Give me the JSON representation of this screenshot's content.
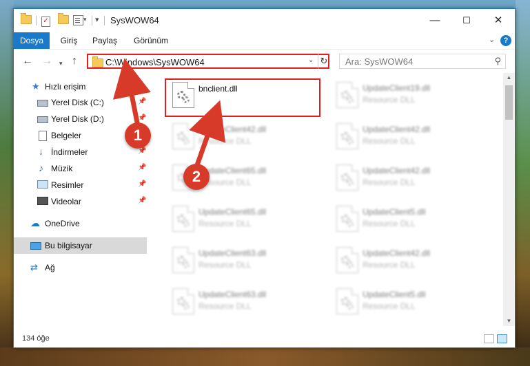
{
  "window": {
    "title": "SysWOW64",
    "controls": {
      "minimize": "—",
      "maximize": "☐",
      "close": "✕"
    }
  },
  "ribbon": {
    "tabs": [
      {
        "label": "Dosya",
        "active": true
      },
      {
        "label": "Giriş"
      },
      {
        "label": "Paylaş"
      },
      {
        "label": "Görünüm"
      }
    ],
    "help": "?"
  },
  "nav": {
    "address": "C:\\Windows\\SysWOW64",
    "search_placeholder": "Ara: SysWOW64"
  },
  "sidebar": {
    "items": [
      {
        "label": "Hızlı erişim",
        "icon": "star-icon"
      },
      {
        "label": "Yerel Disk (C:)",
        "icon": "disk-icon",
        "pinned": true
      },
      {
        "label": "Yerel Disk (D:)",
        "icon": "disk-icon",
        "pinned": true
      },
      {
        "label": "Belgeler",
        "icon": "documents-icon",
        "pinned": true
      },
      {
        "label": "İndirmeler",
        "icon": "download-icon",
        "pinned": true
      },
      {
        "label": "Müzik",
        "icon": "music-icon",
        "pinned": true
      },
      {
        "label": "Resimler",
        "icon": "pictures-icon",
        "pinned": true
      },
      {
        "label": "Videolar",
        "icon": "videos-icon",
        "pinned": true
      },
      {
        "label": "OneDrive",
        "icon": "cloud-icon"
      },
      {
        "label": "Bu bilgisayar",
        "icon": "computer-icon",
        "selected": true
      },
      {
        "label": "Ağ",
        "icon": "network-icon"
      }
    ]
  },
  "files": [
    {
      "name": "bnclient.dll",
      "type": ""
    },
    {
      "name": "UpdateClient19.dll",
      "type": "Resource DLL"
    },
    {
      "name": "UpdateClient42.dll",
      "type": "Resource DLL"
    },
    {
      "name": "UpdateClient42.dll",
      "type": "Resource DLL"
    },
    {
      "name": "UpdateClient65.dll",
      "type": "Resource DLL"
    },
    {
      "name": "UpdateClient42.dll",
      "type": "Resource DLL"
    },
    {
      "name": "UpdateClient65.dll",
      "type": "Resource DLL"
    },
    {
      "name": "UpdateClient5.dll",
      "type": "Resource DLL"
    },
    {
      "name": "UpdateClient63.dll",
      "type": "Resource DLL"
    },
    {
      "name": "UpdateClient42.dll",
      "type": "Resource DLL"
    },
    {
      "name": "UpdateClient63.dll",
      "type": "Resource DLL"
    },
    {
      "name": "UpdateClient5.dll",
      "type": "Resource DLL"
    }
  ],
  "status": {
    "count": "134 öğe"
  },
  "annotations": {
    "one": "1",
    "two": "2"
  },
  "colors": {
    "accent": "#1979ca",
    "highlight": "#e02020",
    "annotation": "#d83a2a"
  }
}
